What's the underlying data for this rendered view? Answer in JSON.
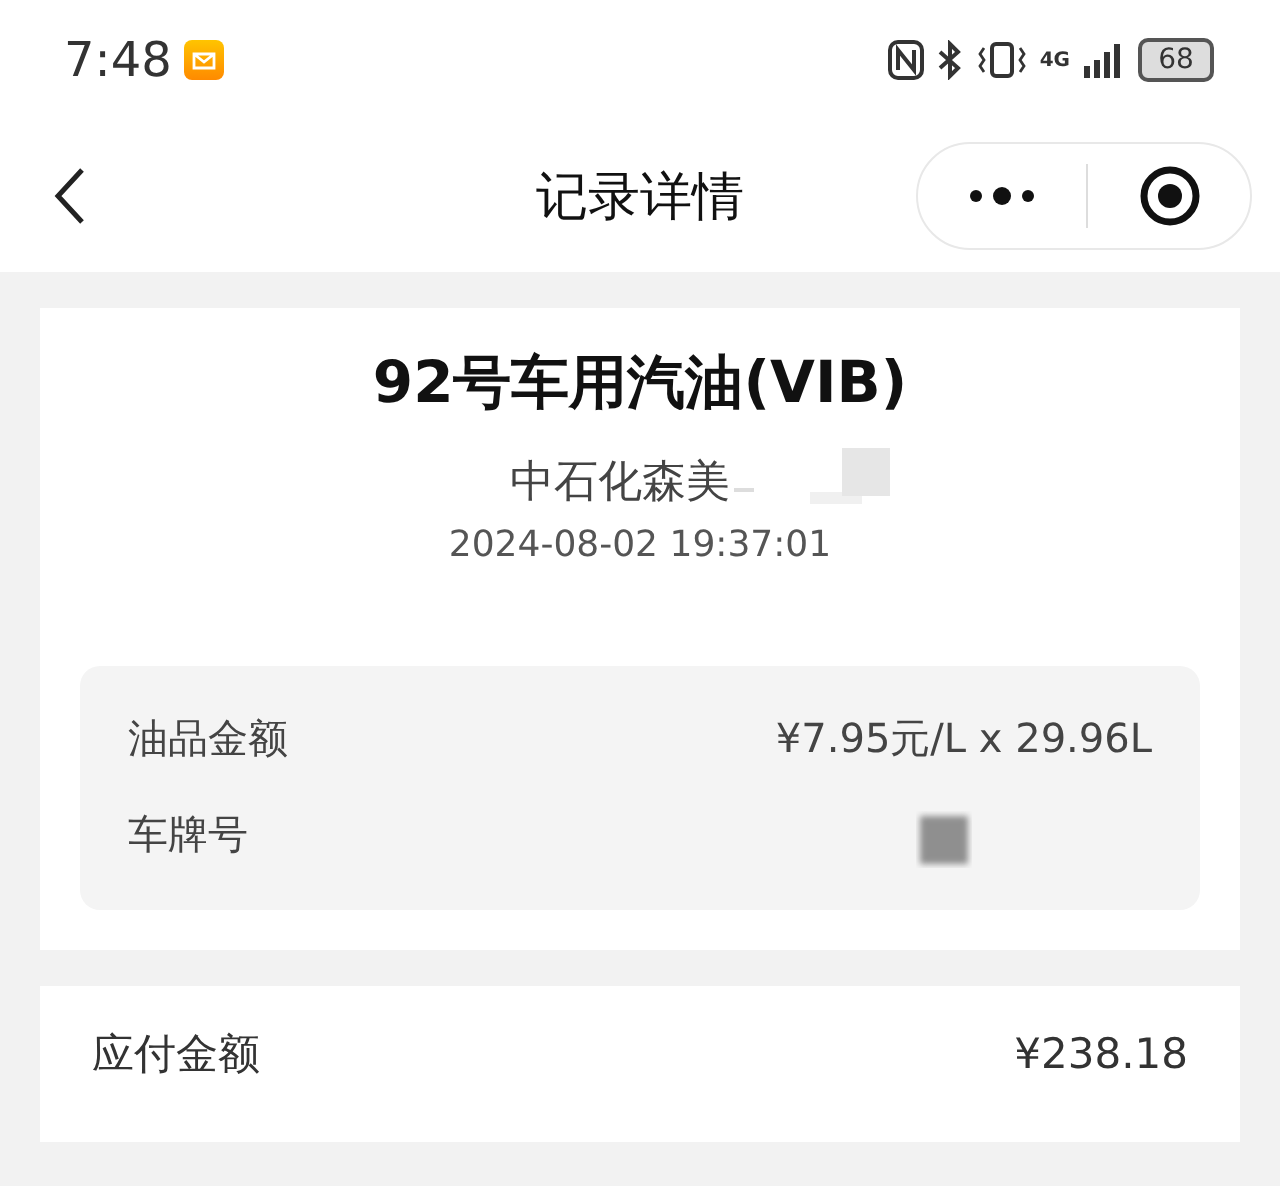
{
  "status_bar": {
    "time": "7:48",
    "battery": "68",
    "network": "4G"
  },
  "nav": {
    "title": "记录详情"
  },
  "record": {
    "product": "92号车用汽油(VIB)",
    "station": "中石化森美",
    "datetime": "2024-08-02 19:37:01",
    "details": [
      {
        "label": "油品金额",
        "value": "¥7.95元/L x 29.96L"
      },
      {
        "label": "车牌号",
        "kind": "redacted"
      }
    ]
  },
  "payment": {
    "label": "应付金额",
    "value": "¥238.18"
  }
}
